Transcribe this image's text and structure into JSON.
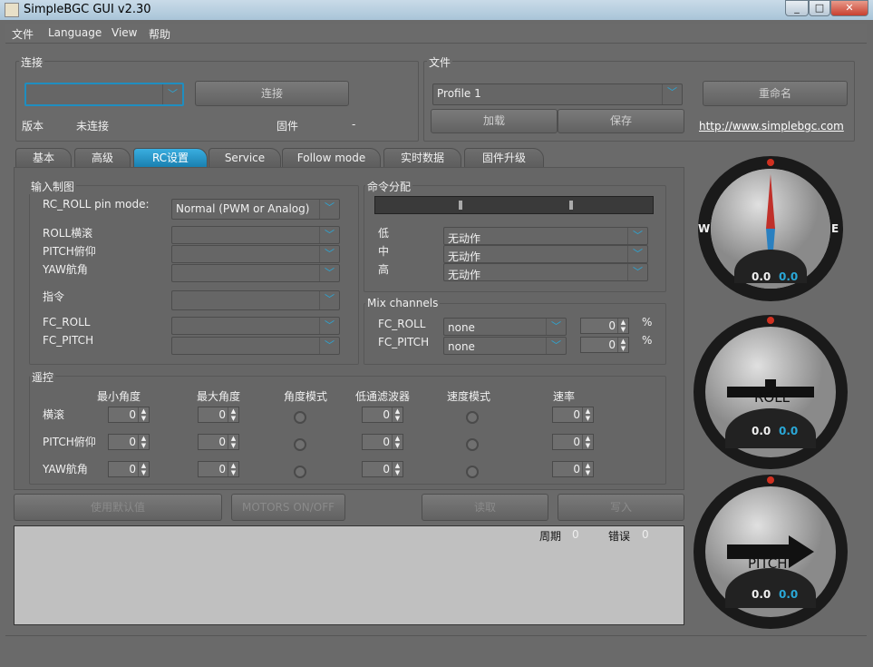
{
  "window": {
    "title": "SimpleBGC GUI v2.30",
    "controls": [
      "_",
      "□",
      "✕"
    ]
  },
  "menu": [
    "文件",
    "Language",
    "View",
    "帮助"
  ],
  "connection": {
    "title": "连接",
    "port_value": "",
    "connect_label": "连接",
    "version_label": "版本",
    "version_value": "未连接",
    "firmware_label": "固件",
    "firmware_value": "-"
  },
  "file": {
    "title": "文件",
    "profile": "Profile 1",
    "rename": "重命名",
    "load": "加载",
    "save": "保存",
    "link": "http://www.simplebgc.com"
  },
  "tabs": [
    "基本",
    "高级",
    "RC设置",
    "Service",
    "Follow mode",
    "实时数据",
    "固件升级"
  ],
  "active_tab": 2,
  "input": {
    "title": "输入制图",
    "pin_mode_label": "RC_ROLL pin mode:",
    "pin_mode_value": "Normal (PWM or Analog)",
    "rows": [
      "ROLL横滚",
      "PITCH俯仰",
      "YAW航角",
      "指令",
      "FC_ROLL",
      "FC_PITCH"
    ]
  },
  "cmd": {
    "title": "命令分配",
    "levels": [
      {
        "label": "低",
        "value": "无动作"
      },
      {
        "label": "中",
        "value": "无动作"
      },
      {
        "label": "高",
        "value": "无动作"
      }
    ]
  },
  "mix": {
    "title": "Mix channels",
    "rows": [
      {
        "label": "FC_ROLL",
        "value": "none",
        "num": "0",
        "unit": "%"
      },
      {
        "label": "FC_PITCH",
        "value": "none",
        "num": "0",
        "unit": "%"
      }
    ]
  },
  "rc": {
    "title": "遥控",
    "headers": [
      "最小角度",
      "最大角度",
      "角度模式",
      "低通滤波器",
      "速度模式",
      "速率"
    ],
    "rows": [
      {
        "label": "横滚",
        "min": "0",
        "max": "0",
        "lpf": "0",
        "rate": "0"
      },
      {
        "label": "PITCH俯仰",
        "min": "0",
        "max": "0",
        "lpf": "0",
        "rate": "0"
      },
      {
        "label": "YAW航角",
        "min": "0",
        "max": "0",
        "lpf": "0",
        "rate": "0"
      }
    ]
  },
  "buttons": {
    "defaults": "使用默认值",
    "motors": "MOTORS ON/OFF",
    "read": "读取",
    "write": "写入"
  },
  "status": {
    "cycle_label": "周期",
    "cycle_value": "0",
    "error_label": "错误",
    "error_value": "0"
  },
  "gauges": {
    "yaw": {
      "w": "W",
      "e": "E",
      "v1": "0.0",
      "v2": "0.0"
    },
    "roll": {
      "label": "ROLL",
      "v1": "0.0",
      "v2": "0.0"
    },
    "pitch": {
      "label": "PITCH",
      "v1": "0.0",
      "v2": "0.0"
    }
  },
  "colors": {
    "accent": "#2aa8d8",
    "bg": "#6a6a6a"
  }
}
